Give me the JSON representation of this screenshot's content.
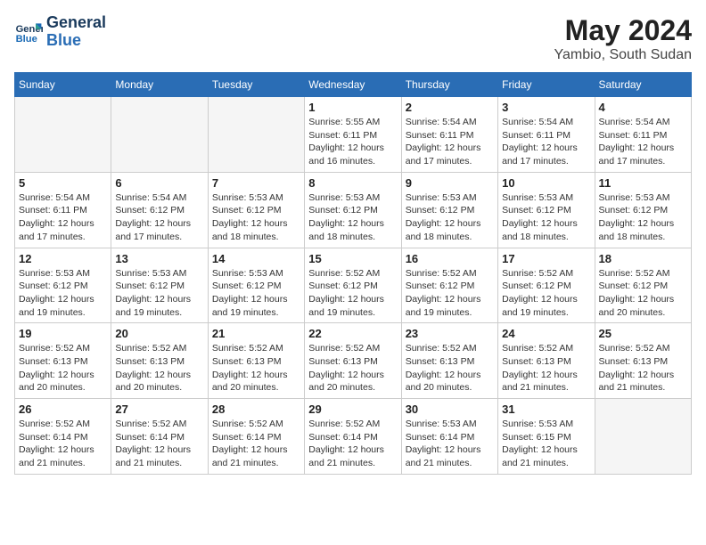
{
  "header": {
    "logo_line1": "General",
    "logo_line2": "Blue",
    "month_year": "May 2024",
    "location": "Yambio, South Sudan"
  },
  "weekdays": [
    "Sunday",
    "Monday",
    "Tuesday",
    "Wednesday",
    "Thursday",
    "Friday",
    "Saturday"
  ],
  "weeks": [
    [
      {
        "day": "",
        "info": ""
      },
      {
        "day": "",
        "info": ""
      },
      {
        "day": "",
        "info": ""
      },
      {
        "day": "1",
        "info": "Sunrise: 5:55 AM\nSunset: 6:11 PM\nDaylight: 12 hours\nand 16 minutes."
      },
      {
        "day": "2",
        "info": "Sunrise: 5:54 AM\nSunset: 6:11 PM\nDaylight: 12 hours\nand 17 minutes."
      },
      {
        "day": "3",
        "info": "Sunrise: 5:54 AM\nSunset: 6:11 PM\nDaylight: 12 hours\nand 17 minutes."
      },
      {
        "day": "4",
        "info": "Sunrise: 5:54 AM\nSunset: 6:11 PM\nDaylight: 12 hours\nand 17 minutes."
      }
    ],
    [
      {
        "day": "5",
        "info": "Sunrise: 5:54 AM\nSunset: 6:11 PM\nDaylight: 12 hours\nand 17 minutes."
      },
      {
        "day": "6",
        "info": "Sunrise: 5:54 AM\nSunset: 6:12 PM\nDaylight: 12 hours\nand 17 minutes."
      },
      {
        "day": "7",
        "info": "Sunrise: 5:53 AM\nSunset: 6:12 PM\nDaylight: 12 hours\nand 18 minutes."
      },
      {
        "day": "8",
        "info": "Sunrise: 5:53 AM\nSunset: 6:12 PM\nDaylight: 12 hours\nand 18 minutes."
      },
      {
        "day": "9",
        "info": "Sunrise: 5:53 AM\nSunset: 6:12 PM\nDaylight: 12 hours\nand 18 minutes."
      },
      {
        "day": "10",
        "info": "Sunrise: 5:53 AM\nSunset: 6:12 PM\nDaylight: 12 hours\nand 18 minutes."
      },
      {
        "day": "11",
        "info": "Sunrise: 5:53 AM\nSunset: 6:12 PM\nDaylight: 12 hours\nand 18 minutes."
      }
    ],
    [
      {
        "day": "12",
        "info": "Sunrise: 5:53 AM\nSunset: 6:12 PM\nDaylight: 12 hours\nand 19 minutes."
      },
      {
        "day": "13",
        "info": "Sunrise: 5:53 AM\nSunset: 6:12 PM\nDaylight: 12 hours\nand 19 minutes."
      },
      {
        "day": "14",
        "info": "Sunrise: 5:53 AM\nSunset: 6:12 PM\nDaylight: 12 hours\nand 19 minutes."
      },
      {
        "day": "15",
        "info": "Sunrise: 5:52 AM\nSunset: 6:12 PM\nDaylight: 12 hours\nand 19 minutes."
      },
      {
        "day": "16",
        "info": "Sunrise: 5:52 AM\nSunset: 6:12 PM\nDaylight: 12 hours\nand 19 minutes."
      },
      {
        "day": "17",
        "info": "Sunrise: 5:52 AM\nSunset: 6:12 PM\nDaylight: 12 hours\nand 19 minutes."
      },
      {
        "day": "18",
        "info": "Sunrise: 5:52 AM\nSunset: 6:12 PM\nDaylight: 12 hours\nand 20 minutes."
      }
    ],
    [
      {
        "day": "19",
        "info": "Sunrise: 5:52 AM\nSunset: 6:13 PM\nDaylight: 12 hours\nand 20 minutes."
      },
      {
        "day": "20",
        "info": "Sunrise: 5:52 AM\nSunset: 6:13 PM\nDaylight: 12 hours\nand 20 minutes."
      },
      {
        "day": "21",
        "info": "Sunrise: 5:52 AM\nSunset: 6:13 PM\nDaylight: 12 hours\nand 20 minutes."
      },
      {
        "day": "22",
        "info": "Sunrise: 5:52 AM\nSunset: 6:13 PM\nDaylight: 12 hours\nand 20 minutes."
      },
      {
        "day": "23",
        "info": "Sunrise: 5:52 AM\nSunset: 6:13 PM\nDaylight: 12 hours\nand 20 minutes."
      },
      {
        "day": "24",
        "info": "Sunrise: 5:52 AM\nSunset: 6:13 PM\nDaylight: 12 hours\nand 21 minutes."
      },
      {
        "day": "25",
        "info": "Sunrise: 5:52 AM\nSunset: 6:13 PM\nDaylight: 12 hours\nand 21 minutes."
      }
    ],
    [
      {
        "day": "26",
        "info": "Sunrise: 5:52 AM\nSunset: 6:14 PM\nDaylight: 12 hours\nand 21 minutes."
      },
      {
        "day": "27",
        "info": "Sunrise: 5:52 AM\nSunset: 6:14 PM\nDaylight: 12 hours\nand 21 minutes."
      },
      {
        "day": "28",
        "info": "Sunrise: 5:52 AM\nSunset: 6:14 PM\nDaylight: 12 hours\nand 21 minutes."
      },
      {
        "day": "29",
        "info": "Sunrise: 5:52 AM\nSunset: 6:14 PM\nDaylight: 12 hours\nand 21 minutes."
      },
      {
        "day": "30",
        "info": "Sunrise: 5:53 AM\nSunset: 6:14 PM\nDaylight: 12 hours\nand 21 minutes."
      },
      {
        "day": "31",
        "info": "Sunrise: 5:53 AM\nSunset: 6:15 PM\nDaylight: 12 hours\nand 21 minutes."
      },
      {
        "day": "",
        "info": ""
      }
    ]
  ]
}
